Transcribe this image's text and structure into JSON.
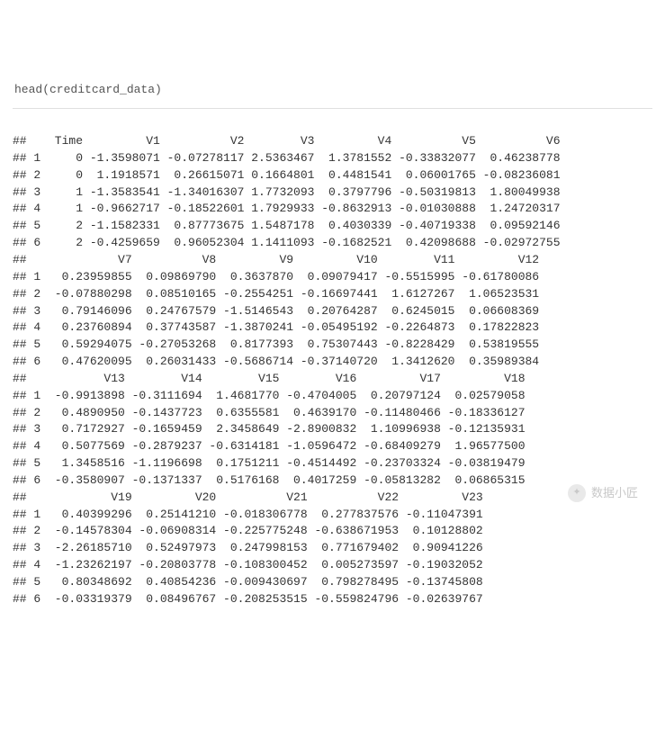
{
  "command_line": "head(creditcard_data)",
  "row_labels": [
    "1",
    "2",
    "3",
    "4",
    "5",
    "6"
  ],
  "blocks": [
    {
      "cols": [
        "Time",
        "V1",
        "V2",
        "V3",
        "V4",
        "V5",
        "V6"
      ],
      "widths": [
        5,
        11,
        12,
        10,
        11,
        12,
        12
      ],
      "rows": [
        [
          "0",
          "-1.3598071",
          "-0.07278117",
          "2.5363467",
          "1.3781552",
          "-0.33832077",
          "0.46238778"
        ],
        [
          "0",
          "1.1918571",
          "0.26615071",
          "0.1664801",
          "0.4481541",
          "0.06001765",
          "-0.08236081"
        ],
        [
          "1",
          "-1.3583541",
          "-1.34016307",
          "1.7732093",
          "0.3797796",
          "-0.50319813",
          "1.80049938"
        ],
        [
          "1",
          "-0.9662717",
          "-0.18522601",
          "1.7929933",
          "-0.8632913",
          "-0.01030888",
          "1.24720317"
        ],
        [
          "2",
          "-1.1582331",
          "0.87773675",
          "1.5487178",
          "0.4030339",
          "-0.40719338",
          "0.09592146"
        ],
        [
          "2",
          "-0.4259659",
          "0.96052304",
          "1.1411093",
          "-0.1682521",
          "0.42098688",
          "-0.02972755"
        ]
      ]
    },
    {
      "cols": [
        "V7",
        "V8",
        "V9",
        "V10",
        "V11",
        "V12"
      ],
      "widths": [
        12,
        12,
        11,
        12,
        11,
        12
      ],
      "rows": [
        [
          "0.23959855",
          "0.09869790",
          "0.3637870",
          "0.09079417",
          "-0.5515995",
          "-0.61780086"
        ],
        [
          "-0.07880298",
          "0.08510165",
          "-0.2554251",
          "-0.16697441",
          "1.6127267",
          "1.06523531"
        ],
        [
          "0.79146096",
          "0.24767579",
          "-1.5146543",
          "0.20764287",
          "0.6245015",
          "0.06608369"
        ],
        [
          "0.23760894",
          "0.37743587",
          "-1.3870241",
          "-0.05495192",
          "-0.2264873",
          "0.17822823"
        ],
        [
          "0.59294075",
          "-0.27053268",
          "0.8177393",
          "0.75307443",
          "-0.8228429",
          "0.53819555"
        ],
        [
          "0.47620095",
          "0.26031433",
          "-0.5686714",
          "-0.37140720",
          "1.3412620",
          "0.35989384"
        ]
      ]
    },
    {
      "cols": [
        "V13",
        "V14",
        "V15",
        "V16",
        "V17",
        "V18"
      ],
      "widths": [
        11,
        11,
        11,
        11,
        12,
        12
      ],
      "rows": [
        [
          "-0.9913898",
          "-0.3111694",
          "1.4681770",
          "-0.4704005",
          "0.20797124",
          "0.02579058"
        ],
        [
          "0.4890950",
          "-0.1437723",
          "0.6355581",
          "0.4639170",
          "-0.11480466",
          "-0.18336127"
        ],
        [
          "0.7172927",
          "-0.1659459",
          "2.3458649",
          "-2.8900832",
          "1.10996938",
          "-0.12135931"
        ],
        [
          "0.5077569",
          "-0.2879237",
          "-0.6314181",
          "-1.0596472",
          "-0.68409279",
          "1.96577500"
        ],
        [
          "1.3458516",
          "-1.1196698",
          "0.1751211",
          "-0.4514492",
          "-0.23703324",
          "-0.03819479"
        ],
        [
          "-0.3580907",
          "-0.1371337",
          "0.5176168",
          "0.4017259",
          "-0.05813282",
          "0.06865315"
        ]
      ]
    },
    {
      "cols": [
        "V19",
        "V20",
        "V21",
        "V22",
        "V23"
      ],
      "widths": [
        12,
        12,
        13,
        13,
        12
      ],
      "rows": [
        [
          "0.40399296",
          "0.25141210",
          "-0.018306778",
          "0.277837576",
          "-0.11047391"
        ],
        [
          "-0.14578304",
          "-0.06908314",
          "-0.225775248",
          "-0.638671953",
          "0.10128802"
        ],
        [
          "-2.26185710",
          "0.52497973",
          "0.247998153",
          "0.771679402",
          "0.90941226"
        ],
        [
          "-1.23262197",
          "-0.20803778",
          "-0.108300452",
          "0.005273597",
          "-0.19032052"
        ],
        [
          "0.80348692",
          "0.40854236",
          "-0.009430697",
          "0.798278495",
          "-0.13745808"
        ],
        [
          "-0.03319379",
          "0.08496767",
          "-0.208253515",
          "-0.559824796",
          "-0.02639767"
        ]
      ]
    }
  ],
  "watermark": "数据小匠",
  "chart_data": {
    "type": "table",
    "title": "head(creditcard_data)",
    "columns": [
      "Time",
      "V1",
      "V2",
      "V3",
      "V4",
      "V5",
      "V6",
      "V7",
      "V8",
      "V9",
      "V10",
      "V11",
      "V12",
      "V13",
      "V14",
      "V15",
      "V16",
      "V17",
      "V18",
      "V19",
      "V20",
      "V21",
      "V22",
      "V23"
    ],
    "rows": [
      [
        0,
        -1.3598071,
        -0.07278117,
        2.5363467,
        1.3781552,
        -0.33832077,
        0.46238778,
        0.23959855,
        0.0986979,
        0.363787,
        0.09079417,
        -0.5515995,
        -0.61780086,
        -0.9913898,
        -0.3111694,
        1.468177,
        -0.4704005,
        0.20797124,
        0.02579058,
        0.40399296,
        0.2514121,
        -0.018306778,
        0.277837576,
        -0.11047391
      ],
      [
        0,
        1.1918571,
        0.26615071,
        0.1664801,
        0.4481541,
        0.06001765,
        -0.08236081,
        -0.07880298,
        0.08510165,
        -0.2554251,
        -0.16697441,
        1.6127267,
        1.06523531,
        0.489095,
        -0.1437723,
        0.6355581,
        0.463917,
        -0.11480466,
        -0.18336127,
        -0.14578304,
        -0.06908314,
        -0.225775248,
        -0.638671953,
        0.10128802
      ],
      [
        1,
        -1.3583541,
        -1.34016307,
        1.7732093,
        0.3797796,
        -0.50319813,
        1.80049938,
        0.79146096,
        0.24767579,
        -1.5146543,
        0.20764287,
        0.6245015,
        0.06608369,
        0.7172927,
        -0.1659459,
        2.3458649,
        -2.8900832,
        1.10996938,
        -0.12135931,
        -2.2618571,
        0.52497973,
        0.247998153,
        0.771679402,
        0.90941226
      ],
      [
        1,
        -0.9662717,
        -0.18522601,
        1.7929933,
        -0.8632913,
        -0.01030888,
        1.24720317,
        0.23760894,
        0.37743587,
        -1.3870241,
        -0.05495192,
        -0.2264873,
        0.17822823,
        0.5077569,
        -0.2879237,
        -0.6314181,
        -1.0596472,
        -0.68409279,
        1.965775,
        -1.23262197,
        -0.20803778,
        -0.108300452,
        0.005273597,
        -0.19032052
      ],
      [
        2,
        -1.1582331,
        0.87773675,
        1.5487178,
        0.4030339,
        -0.40719338,
        0.09592146,
        0.59294075,
        -0.27053268,
        0.8177393,
        0.75307443,
        -0.8228429,
        0.53819555,
        1.3458516,
        -1.1196698,
        0.1751211,
        -0.4514492,
        -0.23703324,
        -0.03819479,
        0.80348692,
        0.40854236,
        -0.009430697,
        0.798278495,
        -0.13745808
      ],
      [
        2,
        -0.4259659,
        0.96052304,
        1.1411093,
        -0.1682521,
        0.42098688,
        -0.02972755,
        0.47620095,
        0.26031433,
        -0.5686714,
        -0.3714072,
        1.341262,
        0.35989384,
        -0.3580907,
        -0.1371337,
        0.5176168,
        0.4017259,
        -0.05813282,
        0.06865315,
        -0.03319379,
        0.08496767,
        -0.208253515,
        -0.559824796,
        -0.02639767
      ]
    ]
  }
}
